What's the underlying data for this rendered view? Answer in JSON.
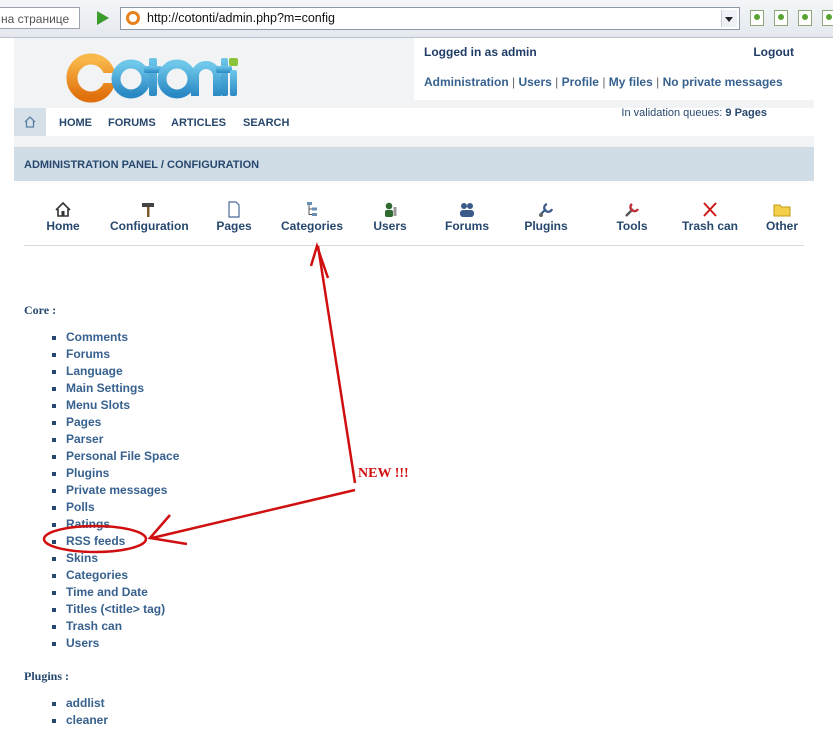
{
  "browser": {
    "find_placeholder": "на странице",
    "url": "http://cotonti/admin.php?m=config"
  },
  "header": {
    "logo_text": "cotonti",
    "logged_in": "Logged in as admin",
    "logout": "Logout",
    "user_links": [
      "Administration",
      "Users",
      "Profile",
      "My files",
      "No private messages"
    ],
    "validation_prefix": "In validation queues:",
    "validation_value": "9 Pages"
  },
  "nav": {
    "items": [
      "HOME",
      "FORUMS",
      "ARTICLES",
      "SEARCH"
    ]
  },
  "panel": {
    "title": "ADMINISTRATION PANEL / CONFIGURATION"
  },
  "admin_tabs": [
    {
      "label": "Home",
      "icon": "home-icon"
    },
    {
      "label": "Configuration",
      "icon": "hammer-icon"
    },
    {
      "label": "Pages",
      "icon": "page-icon"
    },
    {
      "label": "Categories",
      "icon": "tree-icon"
    },
    {
      "label": "Users",
      "icon": "user-icon"
    },
    {
      "label": "Forums",
      "icon": "forums-icon"
    },
    {
      "label": "Plugins",
      "icon": "plugin-icon"
    },
    {
      "label": "Tools",
      "icon": "tools-icon"
    },
    {
      "label": "Trash can",
      "icon": "trash-x-icon"
    },
    {
      "label": "Other",
      "icon": "folder-icon"
    }
  ],
  "core": {
    "heading": "Core :",
    "items": [
      "Comments",
      "Forums",
      "Language",
      "Main Settings",
      "Menu Slots",
      "Pages",
      "Parser",
      "Personal File Space",
      "Plugins",
      "Private messages",
      "Polls",
      "Ratings",
      "RSS feeds",
      "Skins",
      "Categories",
      "Time and Date",
      "Titles (<title> tag)",
      "Trash can",
      "Users"
    ]
  },
  "plugins": {
    "heading": "Plugins :",
    "items": [
      "addlist",
      "cleaner"
    ]
  },
  "annotation": {
    "text": "NEW !!!",
    "color": "#d01010"
  }
}
